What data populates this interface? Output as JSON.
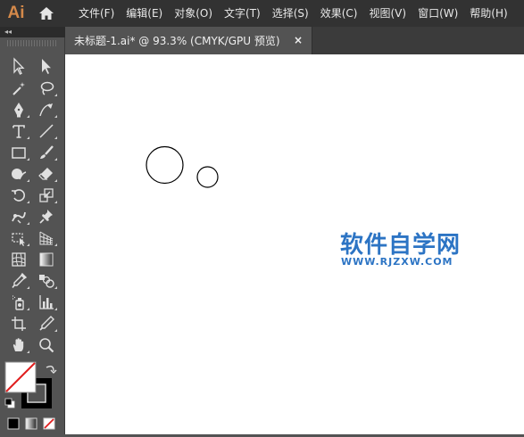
{
  "app": {
    "logo_text": "Ai"
  },
  "menu": {
    "items": [
      "文件(F)",
      "编辑(E)",
      "对象(O)",
      "文字(T)",
      "选择(S)",
      "效果(C)",
      "视图(V)",
      "窗口(W)",
      "帮助(H)"
    ]
  },
  "panel": {
    "collapse_label": "◂◂"
  },
  "document_tab": {
    "title": "未标题-1.ai* @ 93.3% (CMYK/GPU 预览)",
    "close_label": "×"
  },
  "canvas": {
    "watermark_cn": "软件自学网",
    "watermark_url": "WWW.RJZXW.COM"
  },
  "tools": [
    "selection-tool",
    "direct-selection-tool",
    "magic-wand-tool",
    "lasso-tool",
    "pen-tool",
    "curvature-tool",
    "type-tool",
    "line-segment-tool",
    "rectangle-tool",
    "paintbrush-tool",
    "shaper-tool",
    "eraser-tool",
    "rotate-tool",
    "scale-tool",
    "puppet-warp-tool",
    "pin-tool",
    "free-transform-tool",
    "perspective-grid-tool",
    "mesh-tool",
    "gradient-tool",
    "eyedropper-tool",
    "blend-tool",
    "symbol-sprayer-tool",
    "column-graph-tool",
    "artboard-tool",
    "slice-tool",
    "hand-tool",
    "zoom-tool"
  ],
  "colors": {
    "menubar_bg": "#323232",
    "panel_bg": "#535353",
    "logo": "#d4894a",
    "watermark": "#2c74c4",
    "none_slash": "#e01e1e"
  }
}
